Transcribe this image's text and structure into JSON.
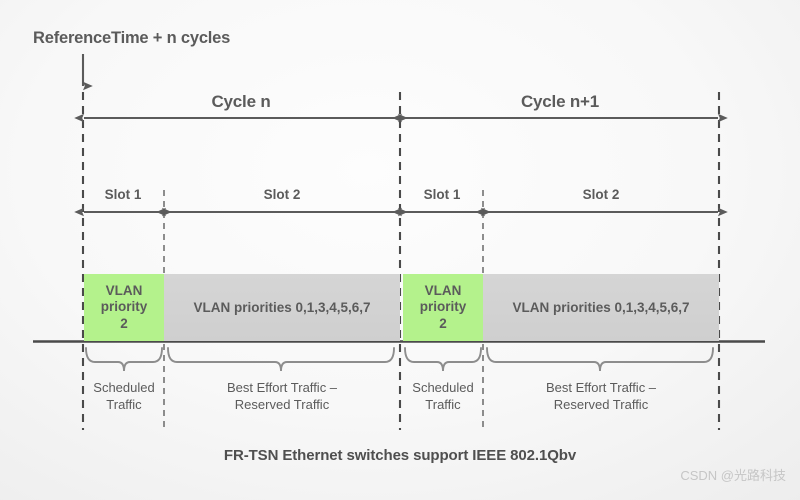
{
  "title_note": "ReferenceTime + n cycles",
  "header": {
    "reference_time_label": "ReferenceTime + n cycles"
  },
  "cycles": [
    {
      "label": "Cycle n"
    },
    {
      "label": "Cycle n+1"
    }
  ],
  "slots": [
    {
      "label": "Slot 1"
    },
    {
      "label": "Slot 2"
    },
    {
      "label": "Slot 1"
    },
    {
      "label": "Slot 2"
    }
  ],
  "blocks": [
    {
      "type": "green",
      "line1": "VLAN",
      "line2": "priority",
      "line3": "2"
    },
    {
      "type": "gray",
      "text": "VLAN priorities 0,1,3,4,5,6,7"
    },
    {
      "type": "green",
      "line1": "VLAN",
      "line2": "priority",
      "line3": "2"
    },
    {
      "type": "gray",
      "text": "VLAN priorities 0,1,3,4,5,6,7"
    }
  ],
  "traffic_labels": [
    {
      "line1": "Scheduled",
      "line2": "Traffic"
    },
    {
      "line1": "Best Effort Traffic –",
      "line2": "Reserved Traffic"
    },
    {
      "line1": "Scheduled",
      "line2": "Traffic"
    },
    {
      "line1": "Best Effort Traffic –",
      "line2": "Reserved Traffic"
    }
  ],
  "caption": "FR-TSN Ethernet switches support IEEE 802.1Qbv",
  "watermark": "CSDN @光路科技",
  "colors": {
    "scheduled_block": "#b4f28c",
    "best_effort_block": "#d2d2d2",
    "line": "#5b5b5b",
    "text": "#5b5b5b"
  }
}
